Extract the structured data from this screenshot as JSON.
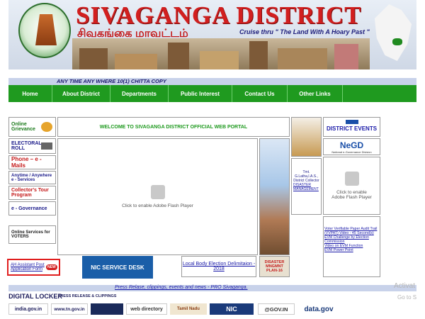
{
  "header": {
    "title": "SIVAGANGA DISTRICT",
    "tamil": "சிவகங்கை மாவட்டம்",
    "tagline": "Cruise thru \" The Land With A Hoary Past \""
  },
  "strip_text": "ANY TIME ANY WHERE 10(1) CHITTA COPY",
  "nav": [
    "Home",
    "About District",
    "Departments",
    "Public Interest",
    "Contact Us",
    "Other Links"
  ],
  "left_links": [
    {
      "label": "Online Grievance",
      "color": "#1a7a1a"
    },
    {
      "label": "ELECTORAL ROLL",
      "color": "#1a1a8a"
    },
    {
      "label": "Phone – e -Mails",
      "color": "#c41a1a"
    },
    {
      "label": "Anytime / Anywhere e - Services",
      "color": "#1a1a8a"
    },
    {
      "label": "Collector's Tour Program",
      "color": "#c41a1a"
    },
    {
      "label": "e - Governance",
      "color": "#1a1a8a"
    },
    {
      "label": "Online Services for VOTERS",
      "color": "#1a1a1a"
    }
  ],
  "welcome": "WELCOME TO SIVAGANGA DISTRICT OFFICIAL WEB PORTAL",
  "flash_text": "Click to enable Adobe Flash Player",
  "collector": {
    "line1": "Tmt.",
    "line2": "G.Latha,I.A.S.,",
    "line3": "District Collector",
    "link": "DISASTER MANAGEMENT"
  },
  "district_events": "DISTRICT EVENTS",
  "negd": "NeGD",
  "negd_sub": "National e-Governance Division",
  "right_links": [
    "Voter Verifiable Paper Audit Trail (VVPAT) Video - 45 Second(s)",
    "EVM Challenge by Election Commission",
    "Video on EVM Function",
    "EVM Power Point"
  ],
  "assistant_post": "AH Assistant Post Application Form",
  "new_badge": "NEW",
  "nic_service": "NIC SERVICE DESK",
  "election_link": "Local Body Election Delimitaion - 2018",
  "disaster_badge": "DISASTER MNGMNT PLAN-16",
  "footer_link": "Press Relase, clippings, events and news - PRO Sivaganga.",
  "bottom_logos": {
    "digital_locker": "DIGITAL LOCKER",
    "press": "PRESS RELEASE & CLIPPINGS",
    "india_gov": "india.gov.in",
    "india_gov_sub": "The national portal of India",
    "tn_gov": "www.tn.gov.in",
    "web_directory": "web directory",
    "tamil_nadu": "Tamil Nadu",
    "nic": "NIC",
    "egov": "@GOV.IN",
    "data_gov": "data.gov"
  },
  "watermark": {
    "line1": "Activat",
    "line2": "Go to S"
  },
  "colors": {
    "nav_green": "#1f9a1f",
    "title_red": "#d21f1f",
    "strip": "#c8d2ea"
  }
}
